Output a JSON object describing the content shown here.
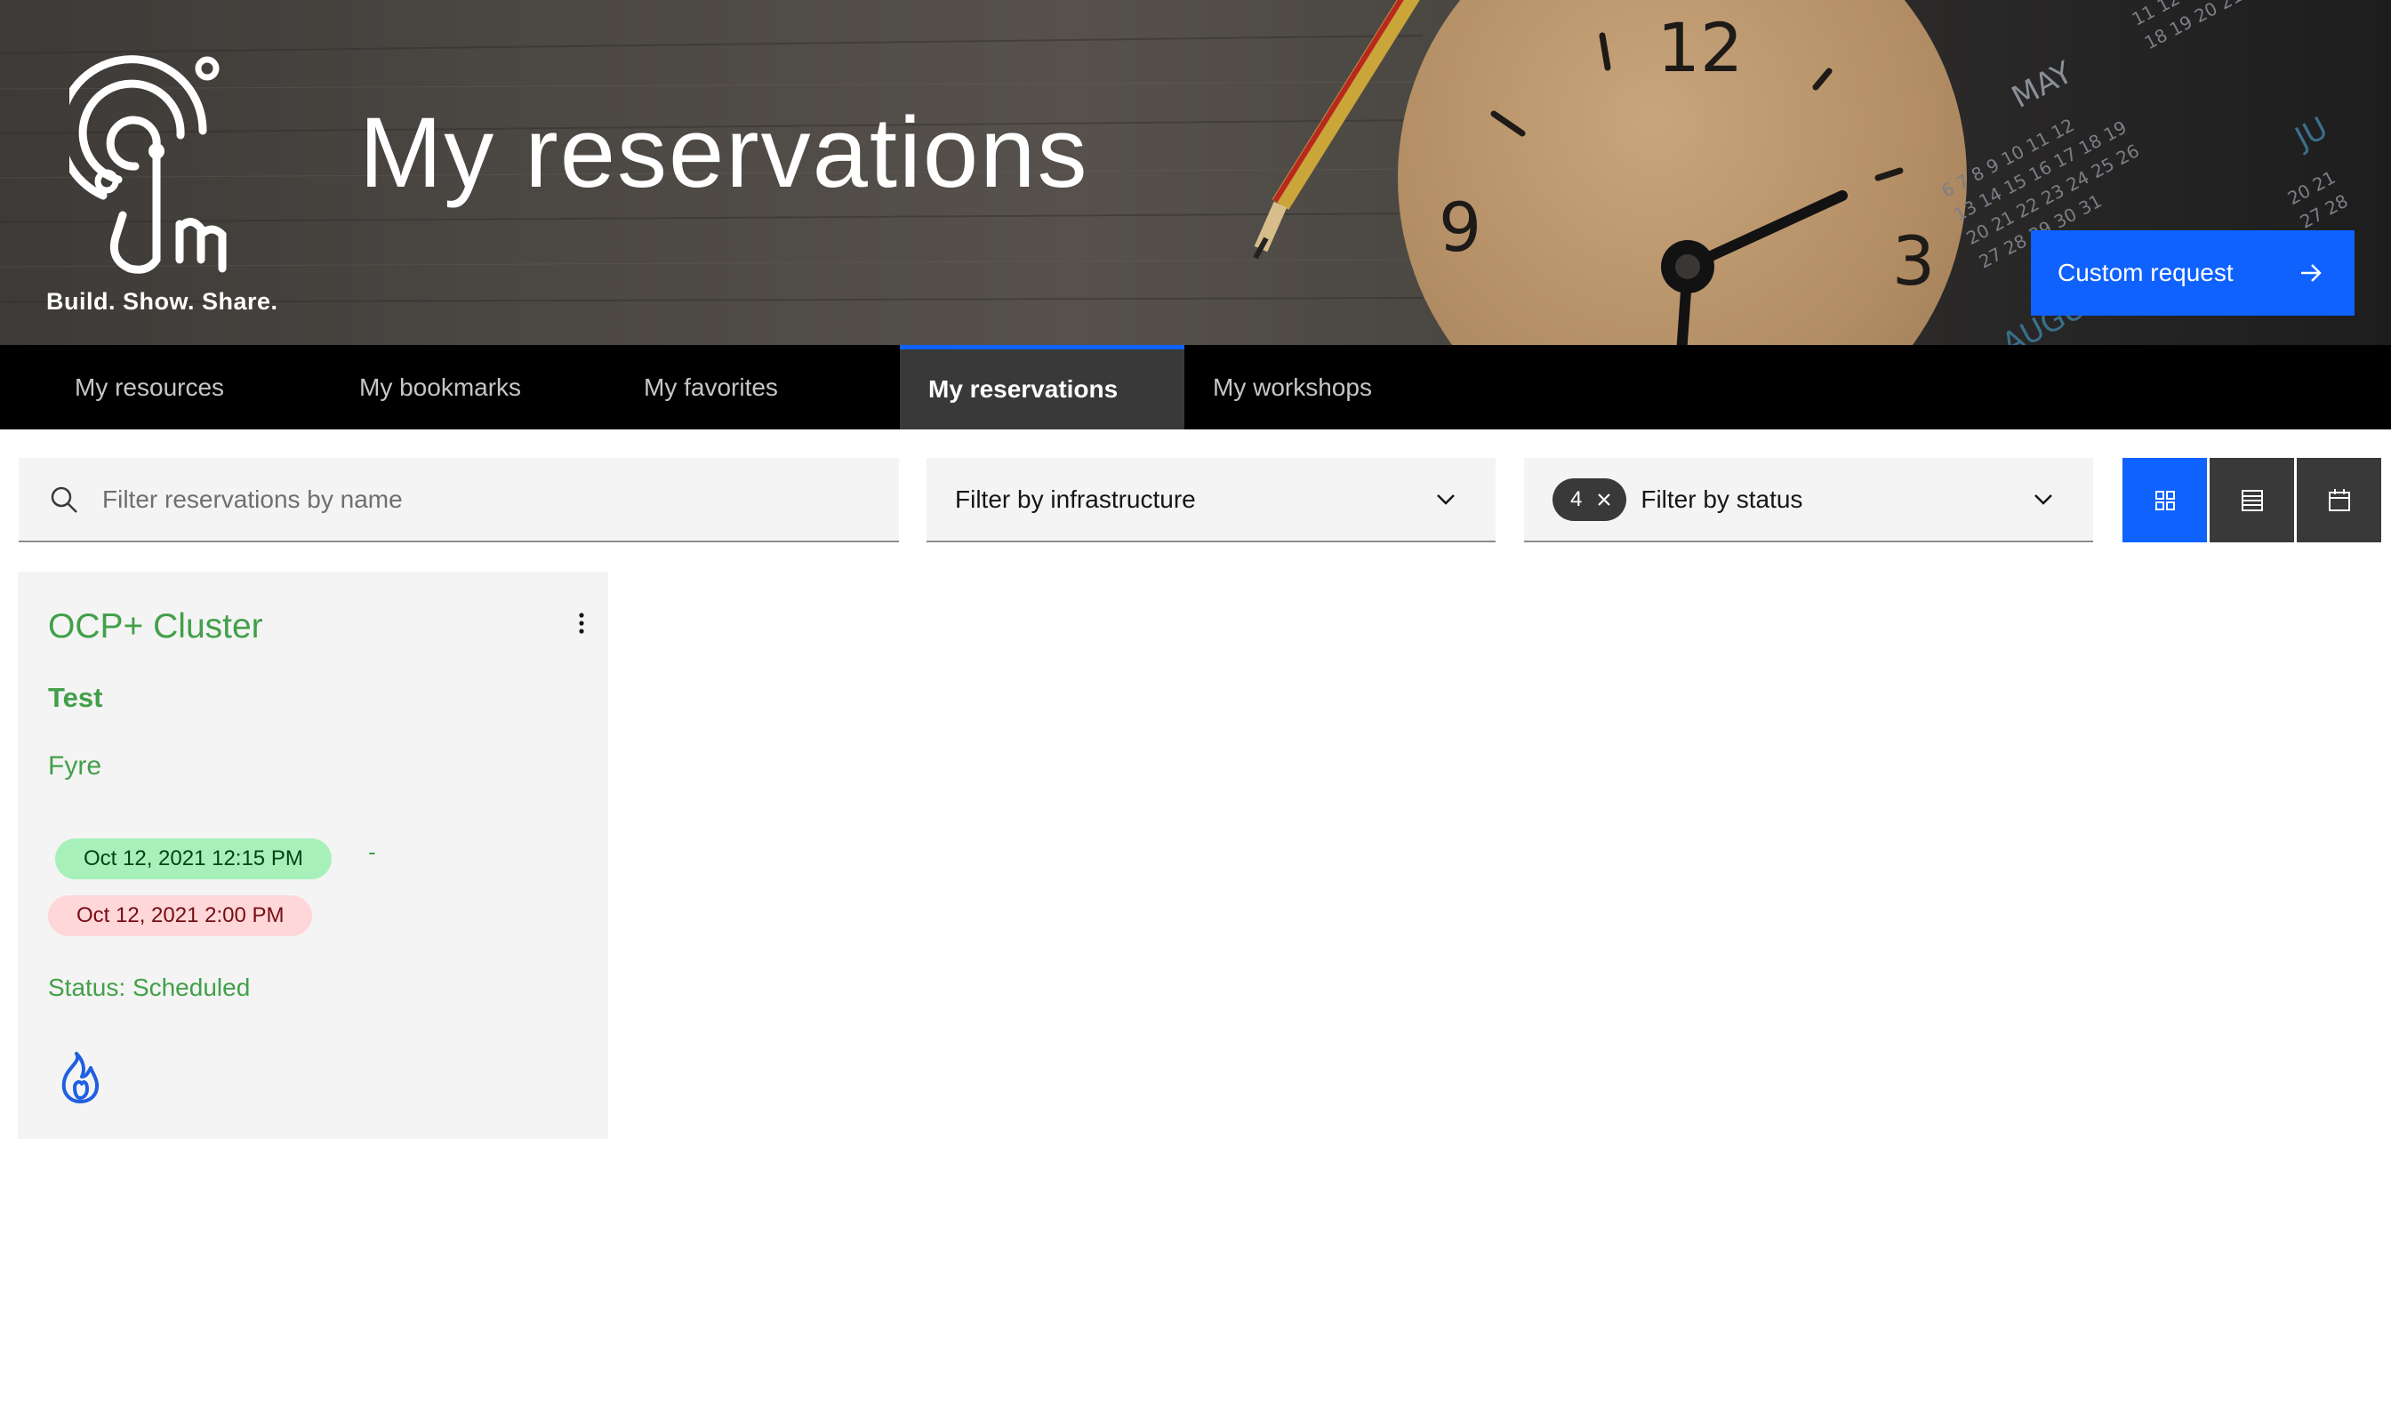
{
  "header": {
    "tagline": "Build. Show. Share.",
    "title": "My reservations",
    "custom_request_label": "Custom request",
    "clock_numbers": [
      "12",
      "3",
      "9"
    ],
    "calendar_months": [
      "MAY",
      "AUGUS",
      "JU"
    ]
  },
  "tabs": [
    {
      "label": "My resources",
      "active": false
    },
    {
      "label": "My bookmarks",
      "active": false
    },
    {
      "label": "My favorites",
      "active": false
    },
    {
      "label": "My reservations",
      "active": true
    },
    {
      "label": "My workshops",
      "active": false
    }
  ],
  "filters": {
    "search_placeholder": "Filter reservations by name",
    "infrastructure_label": "Filter by infrastructure",
    "status_label": "Filter by status",
    "status_selected_count": "4"
  },
  "view_options": [
    {
      "name": "grid-view",
      "active": true
    },
    {
      "name": "list-view",
      "active": false
    },
    {
      "name": "calendar-view",
      "active": false
    }
  ],
  "reservations": [
    {
      "title": "OCP+ Cluster",
      "subtitle": "Test",
      "owner": "Fyre",
      "start": "Oct 12, 2021 12:15 PM",
      "separator": "-",
      "end": "Oct 12, 2021 2:00 PM",
      "status": "Status: Scheduled",
      "icon": "fyre-flame-icon"
    }
  ],
  "colors": {
    "accent": "#0f62fe",
    "card_text": "#42a049",
    "start_badge": "#a7f0ba",
    "end_badge": "#ffd7d9",
    "tab_bar": "#000000",
    "active_tab": "#393939"
  }
}
